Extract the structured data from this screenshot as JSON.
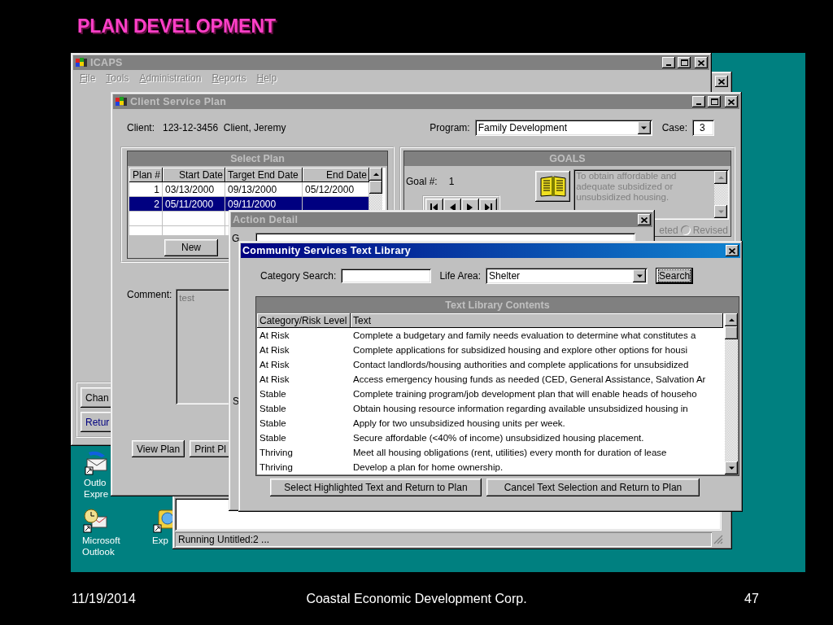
{
  "slide": {
    "title": "PLAN DEVELOPMENT",
    "footer": {
      "date": "11/19/2014",
      "organization": "Coastal Economic Development Corp.",
      "page": "47"
    }
  },
  "desktop": {
    "icons": [
      {
        "kind": "mail",
        "label": [
          "Outlo",
          "Expre"
        ]
      },
      {
        "kind": "outlook",
        "label": [
          "Microsoft",
          "Outlook"
        ]
      },
      {
        "kind": "globe",
        "label": [
          "Exp"
        ]
      }
    ]
  },
  "background_window": {
    "status": "Running Untitled:2 ..."
  },
  "icaps": {
    "title": "ICAPS",
    "active": false,
    "menu": [
      "File",
      "Tools",
      "Administration",
      "Reports",
      "Help"
    ],
    "side_buttons": [
      "Chan",
      "Retur"
    ]
  },
  "client_service_plan": {
    "title": "Client Service Plan",
    "active": false,
    "client_label": "Client:",
    "client": "123-12-3456  Client, Jeremy",
    "program_label": "Program:",
    "program": "Family Development",
    "case_label": "Case:",
    "case": "3",
    "select_plan": {
      "title": "Select Plan",
      "columns": [
        "Plan #",
        "Start Date",
        "Target End Date",
        "End Date"
      ],
      "rows": [
        {
          "cells": [
            "1",
            "03/13/2000",
            "09/13/2000",
            "05/12/2000"
          ],
          "selected": false
        },
        {
          "cells": [
            "2",
            "05/11/2000",
            "09/11/2000"
          ],
          "selected": true
        }
      ],
      "new_button": "New"
    },
    "goals": {
      "title": "GOALS",
      "goal_label": "Goal #:",
      "goal_number": "1",
      "goal_text": "To obtain affordable and adequate subsidized or unsubsidized housing.",
      "status_fragment": "eted",
      "revised": {
        "label": "Revised",
        "selected": false
      }
    },
    "comment_label": "Comment:",
    "comment": "test",
    "bottom_buttons": [
      "View Plan",
      "Print Pl"
    ]
  },
  "action_detail": {
    "title": "Action Detail",
    "active": false,
    "labels": [
      "G",
      "S"
    ]
  },
  "text_library": {
    "title": "Community Services Text Library",
    "active": true,
    "category_label": "Category Search:",
    "life_area_label": "Life Area:",
    "life_area": "Shelter",
    "search_button": "Search",
    "contents_title": "Text Library Contents",
    "columns": [
      "Category/Risk Level",
      "Text"
    ],
    "rows": [
      {
        "category": "At Risk",
        "text": "Complete a budgetary and family needs evaluation to determine what constitutes a",
        "selected": false
      },
      {
        "category": "At Risk",
        "text": "Complete applications for subsidized housing and explore other options for housi",
        "selected": false
      },
      {
        "category": "At Risk",
        "text": "Contact landlords/housing authorities and complete applications for unsubsidized",
        "selected": false
      },
      {
        "category": "At Risk",
        "text": "Access emergency housing funds as needed (CED, General Assistance, Salvation Ar",
        "selected": false
      },
      {
        "category": "Stable",
        "text": "Complete training program/job development plan that will enable heads of househo",
        "selected": false
      },
      {
        "category": "Stable",
        "text": "Obtain housing resource information regarding available unsubsidized housing in",
        "selected": false
      },
      {
        "category": "Stable",
        "text": "Apply for two unsubsidized housing units per week.",
        "selected": false
      },
      {
        "category": "Stable",
        "text": "Secure affordable (<40% of income) unsubsidized housing placement.",
        "selected": false
      },
      {
        "category": "Thriving",
        "text": "Meet all housing obligations (rent, utilities) every month for duration of lease",
        "selected": false
      },
      {
        "category": "Thriving",
        "text": "Develop a plan for home ownership.",
        "selected": false
      }
    ],
    "buttons": [
      "Select Highlighted Text and Return to Plan",
      "Cancel Text Selection and Return to Plan"
    ]
  }
}
